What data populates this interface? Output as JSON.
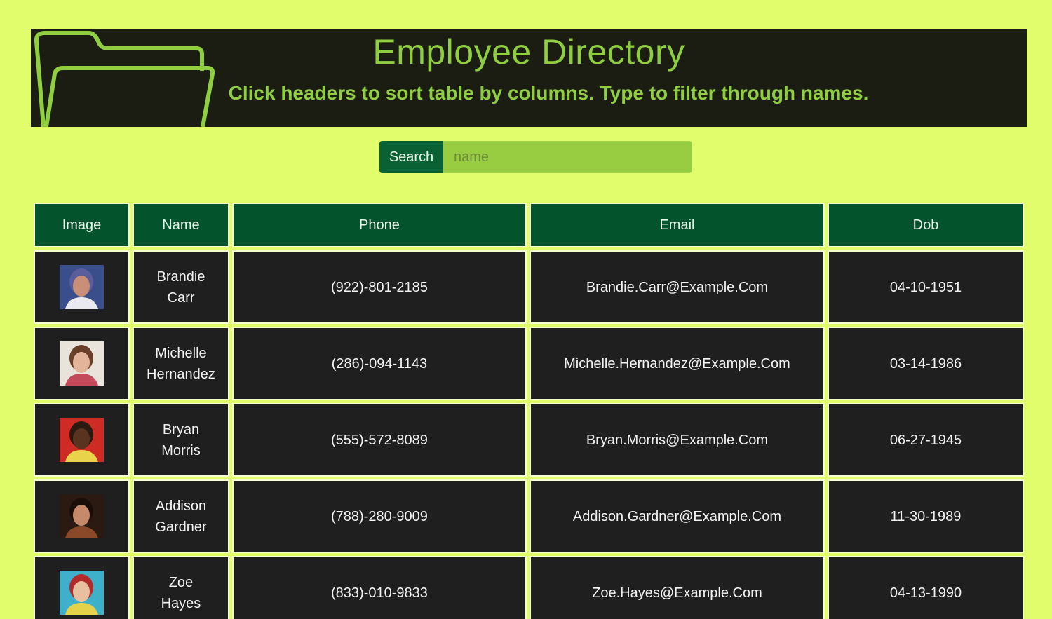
{
  "header": {
    "title": "Employee Directory",
    "subtitle": "Click headers to sort table by columns. Type to filter through names."
  },
  "search": {
    "button_label": "Search",
    "placeholder": "name",
    "value": ""
  },
  "table": {
    "columns": [
      "Image",
      "Name",
      "Phone",
      "Email",
      "Dob"
    ],
    "rows": [
      {
        "first": "Brandie",
        "last": "Carr",
        "phone": "(922)-801-2185",
        "email": "Brandie.Carr@Example.Com",
        "dob": "04-10-1951",
        "avatar": {
          "bg": "#3b4e8c",
          "skin": "#c98f78",
          "hair": "#5a5f9c",
          "accent": "#e9e9f0"
        }
      },
      {
        "first": "Michelle",
        "last": "Hernandez",
        "phone": "(286)-094-1143",
        "email": "Michelle.Hernandez@Example.Com",
        "dob": "03-14-1986",
        "avatar": {
          "bg": "#e8e4dc",
          "skin": "#e2b49a",
          "hair": "#6a3f2a",
          "accent": "#c24a5a"
        }
      },
      {
        "first": "Bryan",
        "last": "Morris",
        "phone": "(555)-572-8089",
        "email": "Bryan.Morris@Example.Com",
        "dob": "06-27-1945",
        "avatar": {
          "bg": "#cf2b25",
          "skin": "#5a3220",
          "hair": "#2a1a10",
          "accent": "#e8d34a"
        }
      },
      {
        "first": "Addison",
        "last": "Gardner",
        "phone": "(788)-280-9009",
        "email": "Addison.Gardner@Example.Com",
        "dob": "11-30-1989",
        "avatar": {
          "bg": "#2a1a12",
          "skin": "#c48a6a",
          "hair": "#1a0e08",
          "accent": "#8a4a2a"
        }
      },
      {
        "first": "Zoe",
        "last": "Hayes",
        "phone": "(833)-010-9833",
        "email": "Zoe.Hayes@Example.Com",
        "dob": "04-13-1990",
        "avatar": {
          "bg": "#3fb0c9",
          "skin": "#e8c0a0",
          "hair": "#b22a2a",
          "accent": "#e3d24a"
        }
      }
    ]
  },
  "colors": {
    "page_bg": "#e2fd6b",
    "banner_bg": "#1b1c12",
    "accent_green": "#8fcf3f",
    "header_cell": "#03532d",
    "body_cell": "#1f1f1f"
  }
}
